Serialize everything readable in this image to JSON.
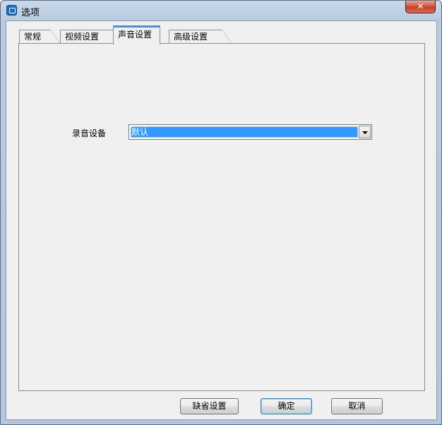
{
  "window": {
    "title": "选项",
    "close_label": "✕"
  },
  "tabs": [
    {
      "label": "常规",
      "active": false
    },
    {
      "label": "视频设置",
      "active": false
    },
    {
      "label": "声音设置",
      "active": true
    },
    {
      "label": "高级设置",
      "active": false
    }
  ],
  "sound": {
    "record_device_label": "录音设备",
    "record_device_value": "默认"
  },
  "buttons": {
    "defaults_label": "缺省设置",
    "ok_label": "确定",
    "cancel_label": "取消"
  },
  "colors": {
    "selection": "#3399ff",
    "active_tab_accent": "#4a92d6",
    "close_button": "#c63f25"
  }
}
